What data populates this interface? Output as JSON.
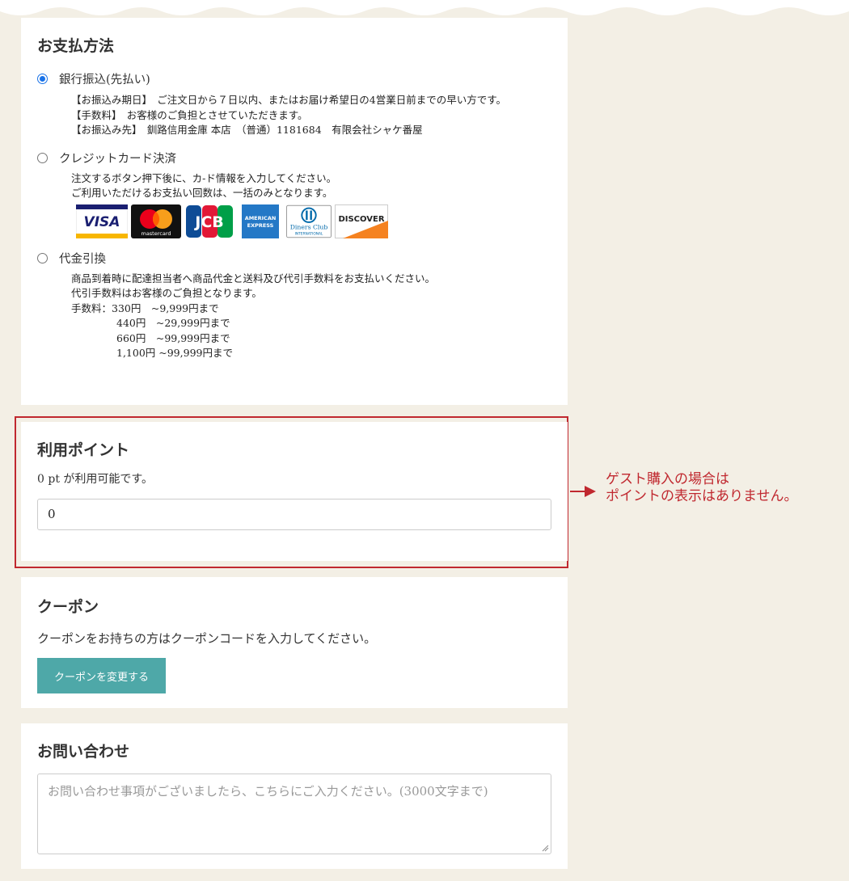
{
  "payment": {
    "title": "お支払方法",
    "bank": {
      "label": "銀行振込(先払い)",
      "selected": true,
      "lines": [
        "【お振込み期日】　ご注文日から７日以内、またはお届け希望日の4営業日前までの早い方です。",
        "【手数料】　お客様のご負担とさせていただきます。",
        "【お振込み先】　釧路信用金庫 本店　（普通）1181684　有限会社シャケ番屋"
      ]
    },
    "card": {
      "label": "クレジットカード決済",
      "selected": false,
      "lines": [
        "注文するボタン押下後に、カ-ド情報を入力してください。",
        "ご利用いただけるお支払い回数は、一括のみとなります。"
      ],
      "brands": {
        "visa": "VISA",
        "mastercard": "mastercard",
        "jcb": "JCB",
        "amex_1": "AMERICAN",
        "amex_2": "EXPRESS",
        "diners_1": "Diners Club",
        "diners_2": "INTERNATIONAL",
        "discover": "DISCOVER"
      }
    },
    "cod": {
      "label": "代金引換",
      "selected": false,
      "lines": [
        "商品到着時に配達担当者へ商品代金と送料及び代引手数料をお支払いください。",
        "代引手数料はお客様のご負担となります。"
      ],
      "fee_label": "手数料：",
      "fees": [
        "330円　~9,999円まで",
        "440円　~29,999円まで",
        "660円　~99,999円まで",
        "1,100円 ~99,999円まで"
      ]
    }
  },
  "points": {
    "title": "利用ポイント",
    "available_text": "0 pt が利用可能です。",
    "input_value": "0"
  },
  "annotation": {
    "line1": "ゲスト購入の場合は",
    "line2": "ポイントの表示はありません。"
  },
  "coupon": {
    "title": "クーポン",
    "description": "クーポンをお持ちの方はクーポンコードを入力してください。",
    "button": "クーポンを変更する"
  },
  "inquiry": {
    "title": "お問い合わせ",
    "placeholder": "お問い合わせ事項がございましたら、こちらにご入力ください。(3000文字まで)"
  },
  "colors": {
    "accent_red": "#c0282f",
    "button_teal": "#4ea8a8",
    "radio_blue": "#1a73e8",
    "background": "#f3efe5"
  }
}
